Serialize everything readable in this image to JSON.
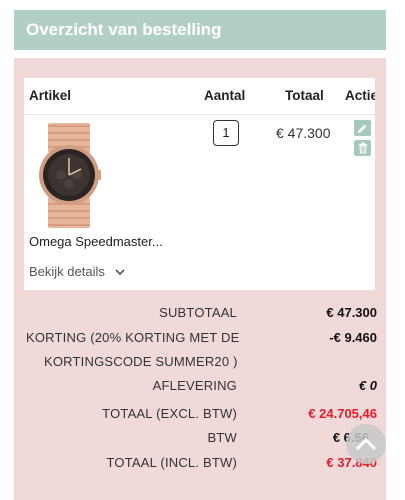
{
  "header": {
    "title": "Overzicht van bestelling"
  },
  "table": {
    "columns": {
      "artikel": "Artikel",
      "aantal": "Aantal",
      "totaal": "Totaal",
      "acties": "Acties"
    },
    "item": {
      "name": "Omega Speedmaster...",
      "quantity": "1",
      "total": "€ 47.300",
      "details_link": "Bekijk details"
    }
  },
  "summary": {
    "subtotal_label": "SUBTOTAAL",
    "subtotal_value": "€ 47.300",
    "discount_label_line1": "KORTING (20% KORTING MET DE",
    "discount_label_line2": "KORTINGSCODE SUMMER20 )",
    "discount_value": "-€ 9.460",
    "delivery_label": "AFLEVERING",
    "delivery_value": "€ 0",
    "total_excl_label": "TOTAAL (EXCL. BTW)",
    "total_excl_value": "€ 24.705,46",
    "btw_label": "BTW",
    "btw_value": "€ 6.56",
    "total_incl_label": "TOTAAL (INCL. BTW)",
    "total_incl_value": "€ 37.840"
  },
  "colors": {
    "header_bg": "#b2cfc3",
    "panel_bg": "#f2d9d9",
    "action_button": "#a7c9bb",
    "highlight_red": "#e11d2a"
  },
  "icons": [
    "pencil-icon",
    "trash-icon",
    "chevron-down-icon",
    "chevron-up-icon"
  ]
}
